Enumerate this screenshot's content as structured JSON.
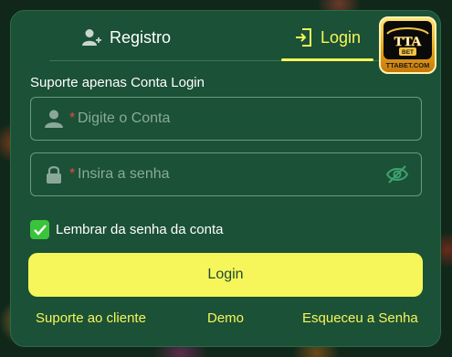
{
  "tabs": {
    "registro_label": "Registro",
    "login_label": "Login",
    "active": "login"
  },
  "logo": {
    "brand_text": "TTA",
    "sub_text": "BET",
    "caption": "TTABET.COM"
  },
  "form": {
    "support_note": "Suporte apenas Conta Login",
    "account": {
      "required_mark": "*",
      "placeholder": "Digite o Conta",
      "value": ""
    },
    "password": {
      "required_mark": "*",
      "placeholder": "Insira a senha",
      "value": ""
    },
    "remember": {
      "label": "Lembrar da senha da conta",
      "checked": true
    },
    "submit_label": "Login"
  },
  "links": {
    "support": "Suporte ao cliente",
    "demo": "Demo",
    "forgot": "Esqueceu a Senha"
  },
  "colors": {
    "panel": "#1b5136",
    "accent": "#f6f65a",
    "checkbox": "#3bc43b",
    "required": "#e84848"
  },
  "icons": {
    "registro": "add-user-icon",
    "login": "login-door-icon",
    "account": "user-icon",
    "password": "lock-icon",
    "visibility": "eye-off-icon",
    "checkbox": "check-icon"
  }
}
